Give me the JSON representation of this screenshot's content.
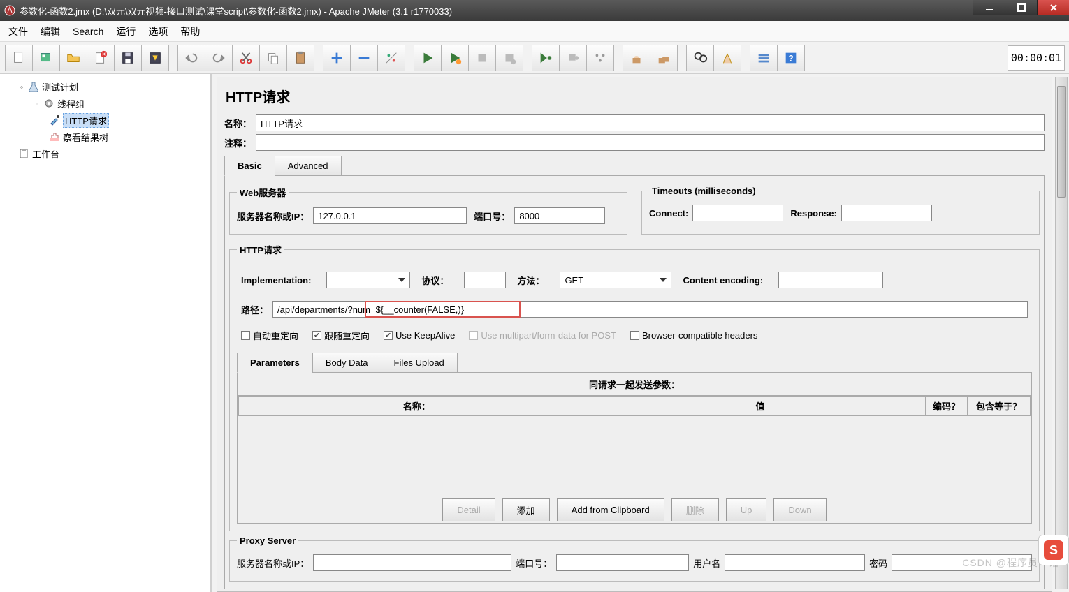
{
  "window": {
    "title": "参数化-函数2.jmx (D:\\双元\\双元视频-接口测试\\课堂script\\参数化-函数2.jmx) - Apache JMeter (3.1 r1770033)"
  },
  "menu": {
    "file": "文件",
    "edit": "编辑",
    "search": "Search",
    "run": "运行",
    "options": "选项",
    "help": "帮助"
  },
  "timer": "00:00:01",
  "tree": {
    "test_plan": "测试计划",
    "thread_group": "线程组",
    "http_request": "HTTP请求",
    "view_results": "察看结果树",
    "workbench": "工作台"
  },
  "panel": {
    "heading": "HTTP请求",
    "name_label": "名称：",
    "name_value": "HTTP请求",
    "comment_label": "注释：",
    "comment_value": "",
    "tabs": {
      "basic": "Basic",
      "advanced": "Advanced"
    },
    "web_legend": "Web服务器",
    "server_label": "服务器名称或IP：",
    "server_value": "127.0.0.1",
    "port_label": "端口号：",
    "port_value": "8000",
    "timeouts_legend": "Timeouts (milliseconds)",
    "connect_label": "Connect:",
    "connect_value": "",
    "response_label": "Response:",
    "response_value": "",
    "http_legend": "HTTP请求",
    "impl_label": "Implementation:",
    "protocol_label": "协议：",
    "protocol_value": "",
    "method_label": "方法：",
    "method_value": "GET",
    "encoding_label": "Content encoding:",
    "encoding_value": "",
    "path_label": "路径：",
    "path_value": "/api/departments/?num=${__counter(FALSE,)}",
    "checks": {
      "auto_redirect": "自动重定向",
      "follow_redirect": "跟随重定向",
      "keepalive": "Use KeepAlive",
      "multipart": "Use multipart/form-data for POST",
      "browser_headers": "Browser-compatible headers"
    },
    "param_tabs": {
      "parameters": "Parameters",
      "body": "Body Data",
      "files": "Files Upload"
    },
    "param_caption": "同请求一起发送参数：",
    "col_name": "名称：",
    "col_value": "值",
    "col_encode": "编码？",
    "col_equals": "包含等于？",
    "buttons": {
      "detail": "Detail",
      "add": "添加",
      "clipboard": "Add from Clipboard",
      "delete": "删除",
      "up": "Up",
      "down": "Down"
    },
    "proxy_legend": "Proxy Server",
    "proxy_server_label": "服务器名称或IP：",
    "proxy_port_label": "端口号：",
    "proxy_user_label": "用户名",
    "proxy_pass_label": "密码"
  },
  "watermark": "CSDN @程序员一诺"
}
